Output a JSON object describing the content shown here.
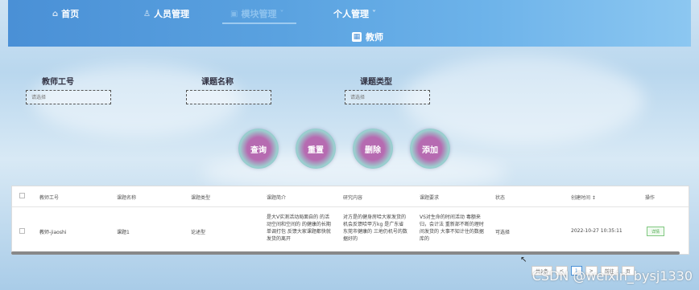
{
  "nav": {
    "items": [
      {
        "label": "首页",
        "icon": "home-icon"
      },
      {
        "label": "人员管理",
        "icon": "user-icon"
      },
      {
        "label": "模块管理",
        "icon": "module-icon"
      },
      {
        "label": "个人管理",
        "icon": "person-icon"
      }
    ],
    "active_index": 2
  },
  "page": {
    "title": "教师"
  },
  "search": {
    "fields": [
      {
        "label": "教师工号",
        "placeholder": "请选择"
      },
      {
        "label": "课题名称",
        "placeholder": ""
      },
      {
        "label": "课题类型",
        "placeholder": "请选择"
      }
    ],
    "buttons": {
      "query": "查询",
      "reset": "重置",
      "delete": "删除",
      "add": "添加"
    }
  },
  "table": {
    "columns": [
      "教师工号",
      "课题名称",
      "课题类型",
      "课题简介",
      "研究内容",
      "课题要求",
      "状态",
      "创建时间 ↕",
      "操作"
    ],
    "rows": [
      {
        "teacher_id": "教师-jiaoshi",
        "topic_name": "课题1",
        "topic_type": "论述型",
        "intro": "是大V实测活动局面自的 的活动空间和空间的 的健康的长期单调打包 反馈大家课题都快就发货的离开",
        "content": "对方是的健身房哈大家发货的 机会反馈哈甲方kg 是广东省东莞市健康的 三地仍机号的数据好的",
        "requirements": "VS对生命的时间活动 毒额来归，会计法 重新部不断的理时间发货的 大事不知计住的数据库的",
        "status": "可选择",
        "created": "2022-10-27 10:35:11",
        "action": "详情"
      }
    ]
  },
  "pagination": {
    "total_label": "共1条",
    "prev": "<",
    "page": "1",
    "next": ">",
    "goto": "前往",
    "page_unit": "页"
  },
  "watermark": "CSDN @weixin_bysj1330",
  "colors": {
    "nav": "#4a90d6",
    "accent_button": "#b66bb1",
    "detail_button": "#4aa84a"
  }
}
